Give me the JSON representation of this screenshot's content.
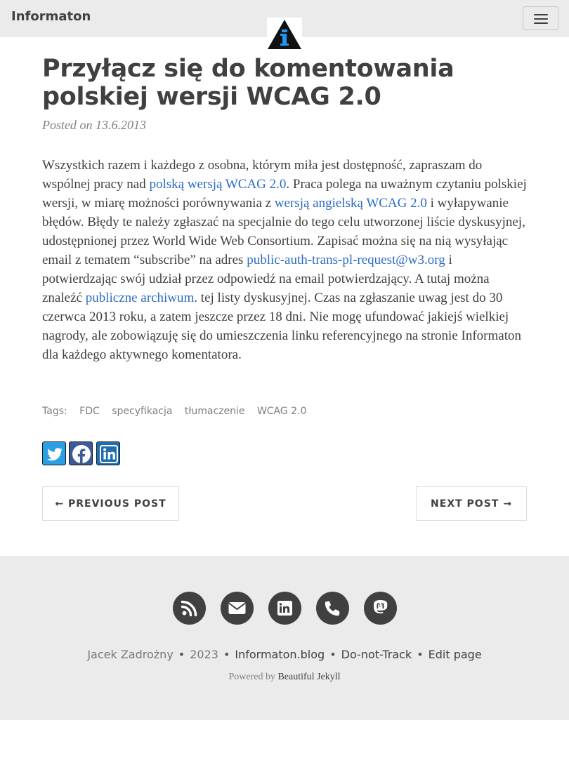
{
  "nav": {
    "brand": "Informaton"
  },
  "post": {
    "title": "Przyłącz się do komentowania polskiej wersji WCAG 2.0",
    "meta": "Posted on 13.6.2013",
    "p1": "Wszystkich razem i każdego z osobna, którym miła jest dostępność, zapraszam do wspólnej pracy nad ",
    "link1": "polską wersją WCAG 2.0",
    "p2": ". Praca polega na uważnym czytaniu polskiej wersji, w miarę możności porównywania z ",
    "link2": "wersją angielską WCAG 2.0",
    "p3": " i wyłapywanie błędów. Błędy te należy zgłaszać na specjalnie do tego celu utworzonej liście dyskusyjnej, udostępnionej przez World Wide Web Consortium. Zapisać można się na nią wysyłając email z tematem “subscribe” na adres ",
    "link3": "public-auth-trans-pl-request@w3.org",
    "p4": " i potwierdzając swój udział przez odpowiedź na email potwierdzający. A tutaj można znaleźć ",
    "link4": "publiczne archiwum",
    "p5": ". tej listy dyskusyjnej. Czas na zgłaszanie uwag jest do 30 czerwca 2013 roku, a zatem jeszcze przez 18 dni. Nie mogę ufundować jakiejś wielkiej nagrody, ale zobowiązuję się do umieszczenia linku referencyjnego na stronie Informaton dla każdego aktywnego komentatora."
  },
  "tags": {
    "label": "Tags:",
    "items": [
      "FDC",
      "specyfikacja",
      "tłumaczenie",
      "WCAG 2.0"
    ]
  },
  "share": {
    "icons": [
      "twitter-icon",
      "facebook-icon",
      "linkedin-icon"
    ]
  },
  "pager": {
    "previous": "← PREVIOUS POST",
    "next": "NEXT POST →"
  },
  "footer": {
    "icons": [
      "rss-icon",
      "envelope-icon",
      "linkedin-icon",
      "phone-icon",
      "mastodon-icon"
    ],
    "author": "Jacek Zadrożny",
    "sep": "•",
    "year": "2023",
    "blog": "Informaton.blog",
    "dnt": "Do-not-Track",
    "edit": "Edit page",
    "powered_by": "Powered by",
    "engine": "Beautiful Jekyll"
  },
  "colors": {
    "link": "#2b6cc4",
    "logo_blue": "#2196f3",
    "footer_bg": "#ebebeb",
    "icon_bg": "#404040"
  }
}
